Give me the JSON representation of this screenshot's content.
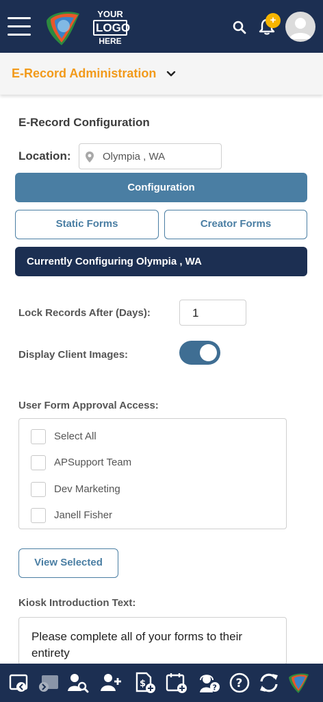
{
  "header": {
    "logo_line1": "YOUR",
    "logo_line2": "LOGO",
    "logo_line3": "HERE",
    "notification_badge": "+"
  },
  "subheader": {
    "title": "E-Record Administration"
  },
  "config": {
    "section_title": "E-Record Configuration",
    "location_label": "Location:",
    "location_value": "Olympia , WA",
    "configuration_button": "Configuration",
    "static_forms_button": "Static Forms",
    "creator_forms_button": "Creator Forms",
    "current_banner": "Currently Configuring Olympia , WA",
    "lock_label": "Lock Records After (Days):",
    "lock_value": "1",
    "display_images_label": "Display Client Images:",
    "display_images_on": true,
    "approval_label": "User Form Approval Access:",
    "approval_options": [
      "Select All",
      "APSupport Team",
      "Dev Marketing",
      "Janell Fisher"
    ],
    "view_selected_button": "View Selected",
    "kiosk_label": "Kiosk Introduction Text:",
    "kiosk_text": "Please complete all of your forms to their entirety"
  },
  "colors": {
    "navy": "#1c2f52",
    "accent_blue": "#4a7ea3",
    "orange_title": "#f29a1a",
    "badge_yellow": "#f7b500"
  },
  "toolbar_icons": [
    "checkout-icon",
    "checkin-icon",
    "client-search-icon",
    "add-client-icon",
    "add-billing-icon",
    "add-appointment-icon",
    "support-icon",
    "help-icon",
    "sync-icon",
    "app-logo-icon"
  ]
}
